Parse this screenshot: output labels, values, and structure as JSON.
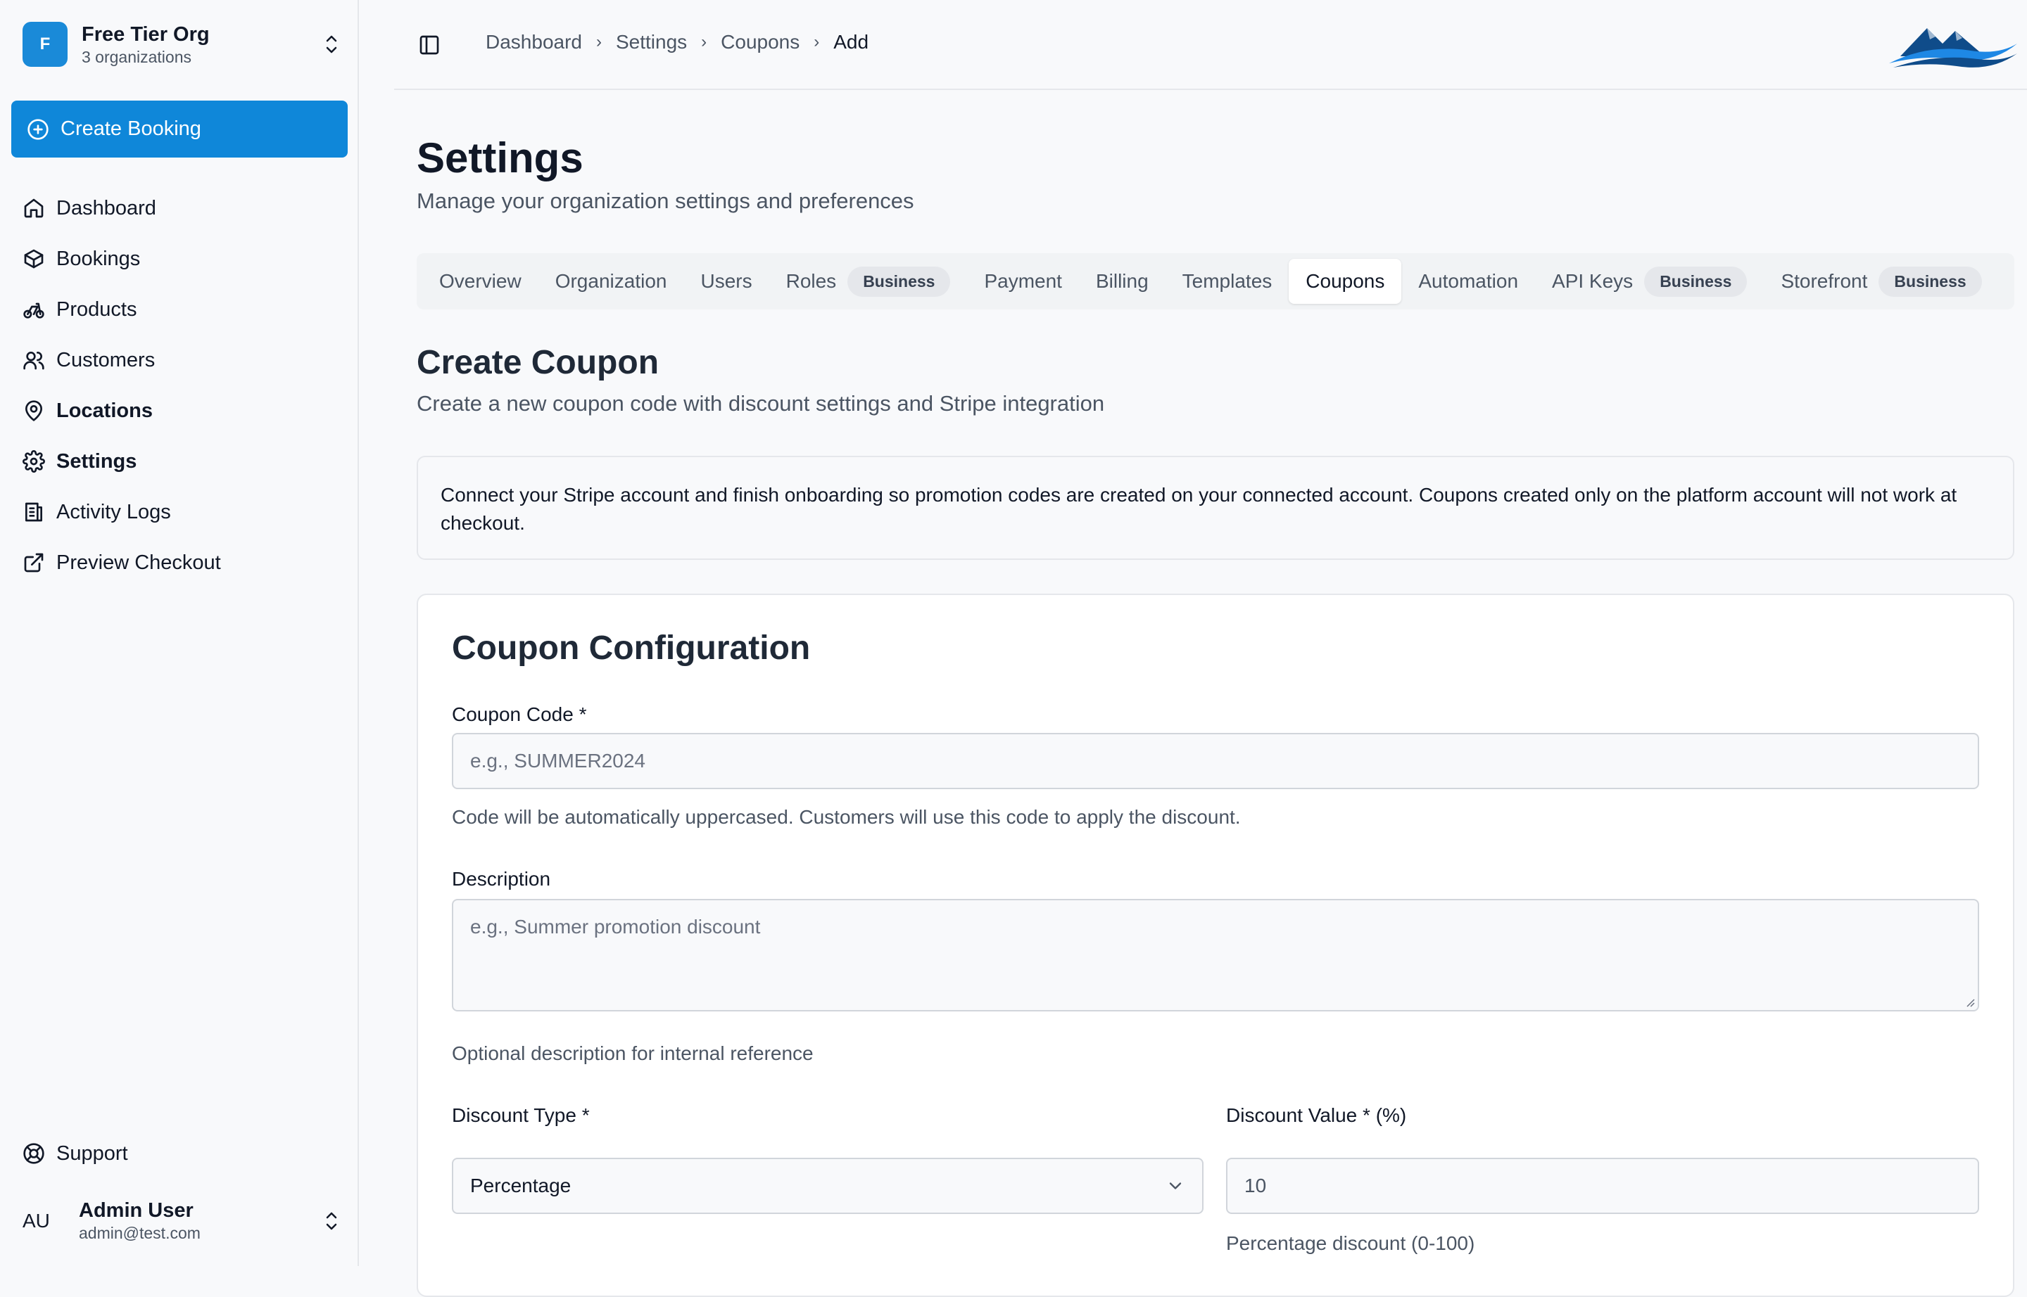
{
  "org": {
    "initial": "F",
    "name": "Free Tier Org",
    "sub": "3 organizations"
  },
  "create_booking": "Create Booking",
  "nav": [
    {
      "label": "Dashboard",
      "icon": "home-icon"
    },
    {
      "label": "Bookings",
      "icon": "box-icon"
    },
    {
      "label": "Products",
      "icon": "bike-icon"
    },
    {
      "label": "Customers",
      "icon": "users-icon"
    },
    {
      "label": "Locations",
      "icon": "map-pin-icon"
    },
    {
      "label": "Settings",
      "icon": "gear-icon"
    },
    {
      "label": "Activity Logs",
      "icon": "logs-icon"
    },
    {
      "label": "Preview Checkout",
      "icon": "external-link-icon"
    }
  ],
  "support": "Support",
  "user": {
    "initials": "AU",
    "name": "Admin User",
    "email": "admin@test.com"
  },
  "breadcrumb": [
    "Dashboard",
    "Settings",
    "Coupons",
    "Add"
  ],
  "page": {
    "title": "Settings",
    "subtitle": "Manage your organization settings and preferences"
  },
  "tabs": [
    {
      "label": "Overview"
    },
    {
      "label": "Organization"
    },
    {
      "label": "Users"
    },
    {
      "label": "Roles",
      "badge": "Business"
    },
    {
      "label": "Payment"
    },
    {
      "label": "Billing"
    },
    {
      "label": "Templates"
    },
    {
      "label": "Coupons",
      "active": true
    },
    {
      "label": "Automation"
    },
    {
      "label": "API Keys",
      "badge": "Business"
    },
    {
      "label": "Storefront",
      "badge": "Business"
    }
  ],
  "section": {
    "title": "Create Coupon",
    "subtitle": "Create a new coupon code with discount settings and Stripe integration"
  },
  "alert": "Connect your Stripe account and finish onboarding so promotion codes are created on your connected account. Coupons created only on the platform account will not work at checkout.",
  "form": {
    "title": "Coupon Configuration",
    "code_label": "Coupon Code *",
    "code_placeholder": "e.g., SUMMER2024",
    "code_help": "Code will be automatically uppercased. Customers will use this code to apply the discount.",
    "desc_label": "Description",
    "desc_placeholder": "e.g., Summer promotion discount",
    "desc_help": "Optional description for internal reference",
    "type_label": "Discount Type *",
    "type_value": "Percentage",
    "value_label": "Discount Value * (%)",
    "value_value": "10",
    "value_help": "Percentage discount (0-100)"
  },
  "colors": {
    "accent": "#0f87d9",
    "text": "#111827",
    "muted": "#4b5563",
    "border": "#e5e7eb"
  }
}
